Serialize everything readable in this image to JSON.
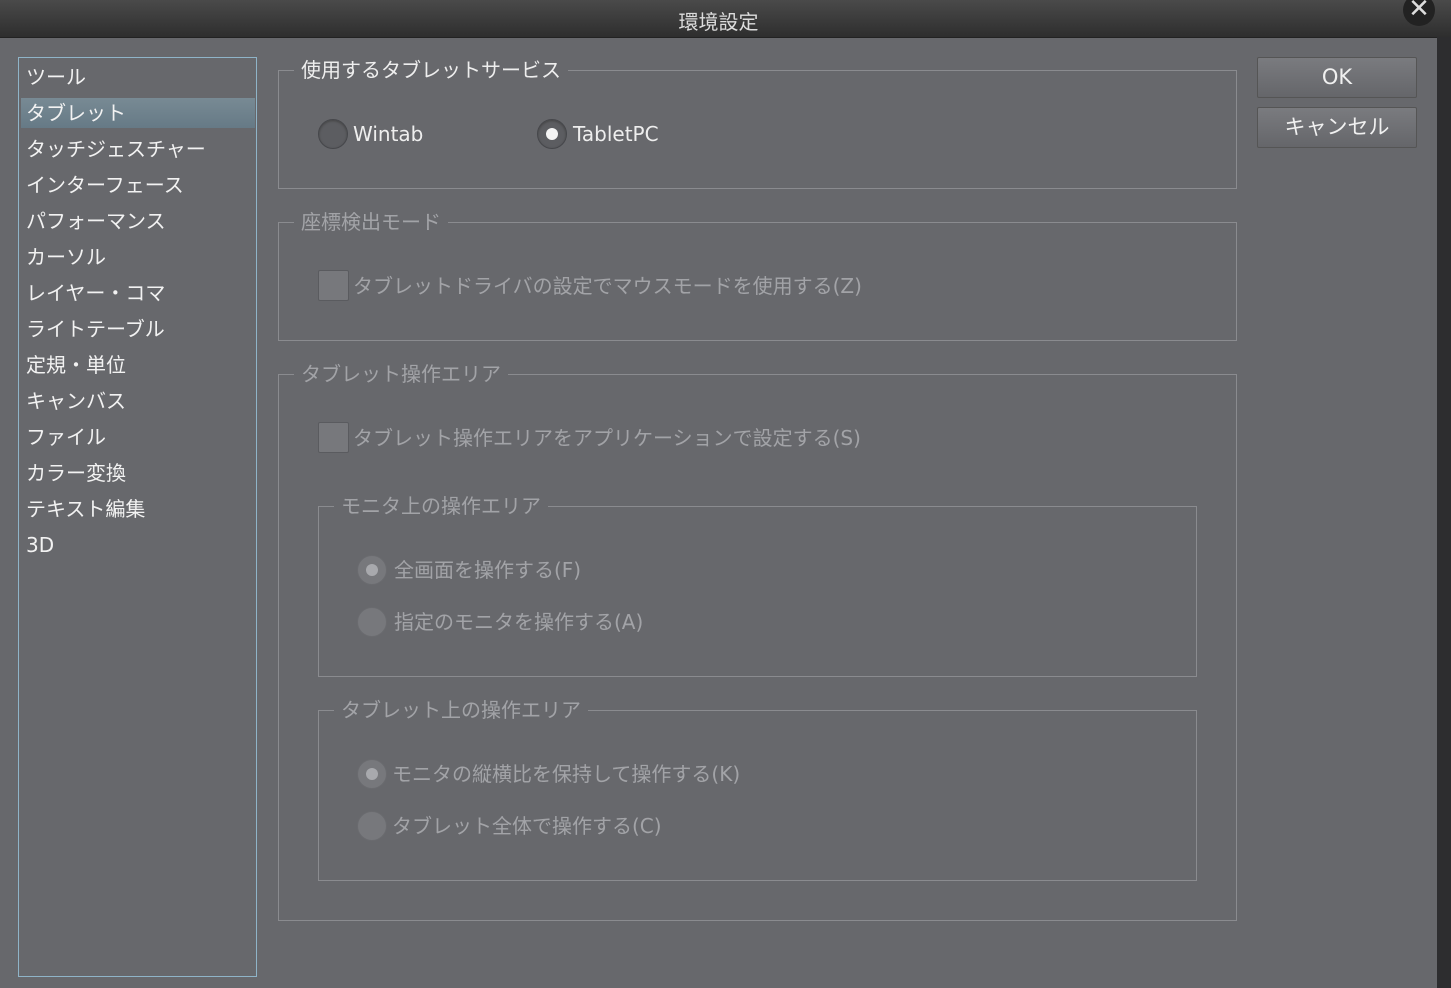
{
  "window": {
    "title": "環境設定"
  },
  "sidebar": {
    "items": [
      "ツール",
      "タブレット",
      "タッチジェスチャー",
      "インターフェース",
      "パフォーマンス",
      "カーソル",
      "レイヤー・コマ",
      "ライトテーブル",
      "定規・単位",
      "キャンバス",
      "ファイル",
      "カラー変換",
      "テキスト編集",
      "3D"
    ],
    "selected": 1
  },
  "tablet_service": {
    "legend": "使用するタブレットサービス",
    "wintab": "Wintab",
    "tabletpc": "TabletPC",
    "selected": "TabletPC"
  },
  "coord_mode": {
    "legend": "座標検出モード",
    "mouse_mode": "タブレットドライバの設定でマウスモードを使用する(Z)",
    "mouse_mode_checked": false
  },
  "area": {
    "legend": "タブレット操作エリア",
    "app_setting": "タブレット操作エリアをアプリケーションで設定する(S)",
    "app_setting_checked": false,
    "monitor": {
      "legend": "モニタ上の操作エリア",
      "full": "全画面を操作する(F)",
      "specific": "指定のモニタを操作する(A)",
      "selected": "full"
    },
    "tablet": {
      "legend": "タブレット上の操作エリア",
      "keep_ratio": "モニタの縦横比を保持して操作する(K)",
      "whole": "タブレット全体で操作する(C)",
      "selected": "keep_ratio"
    }
  },
  "buttons": {
    "ok": "OK",
    "cancel": "キャンセル"
  }
}
